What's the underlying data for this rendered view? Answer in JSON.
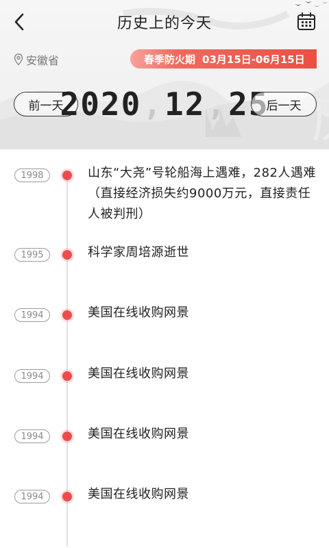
{
  "header": {
    "title": "历史上的今天",
    "back_icon": "chevron-left-icon",
    "calendar_icon": "calendar-icon"
  },
  "location": {
    "icon": "location-pin-icon",
    "text": "安徽省"
  },
  "fire_season": {
    "label": "春季防火期",
    "range": "03月15日-06月15日"
  },
  "date_nav": {
    "prev_label": "前一天",
    "next_label": "后一天",
    "year": "2020",
    "month": "12",
    "day": "25",
    "separator": ","
  },
  "events": [
    {
      "year": "1998",
      "text": "山东“大尧”号轮船海上遇难，282人遇难（直接经济损失约9000万元，直接责任人被判刑）"
    },
    {
      "year": "1995",
      "text": "科学家周培源逝世"
    },
    {
      "year": "1994",
      "text": "美国在线收购网景"
    },
    {
      "year": "1994",
      "text": "美国在线收购网景"
    },
    {
      "year": "1994",
      "text": "美国在线收购网景"
    },
    {
      "year": "1994",
      "text": "美国在线收购网景"
    }
  ],
  "colors": {
    "accent": "#ef4b4d",
    "badge_gradient_start": "#f8a29a",
    "badge_gradient_end": "#ec4f44",
    "header_bg": "#f2f2f2"
  }
}
